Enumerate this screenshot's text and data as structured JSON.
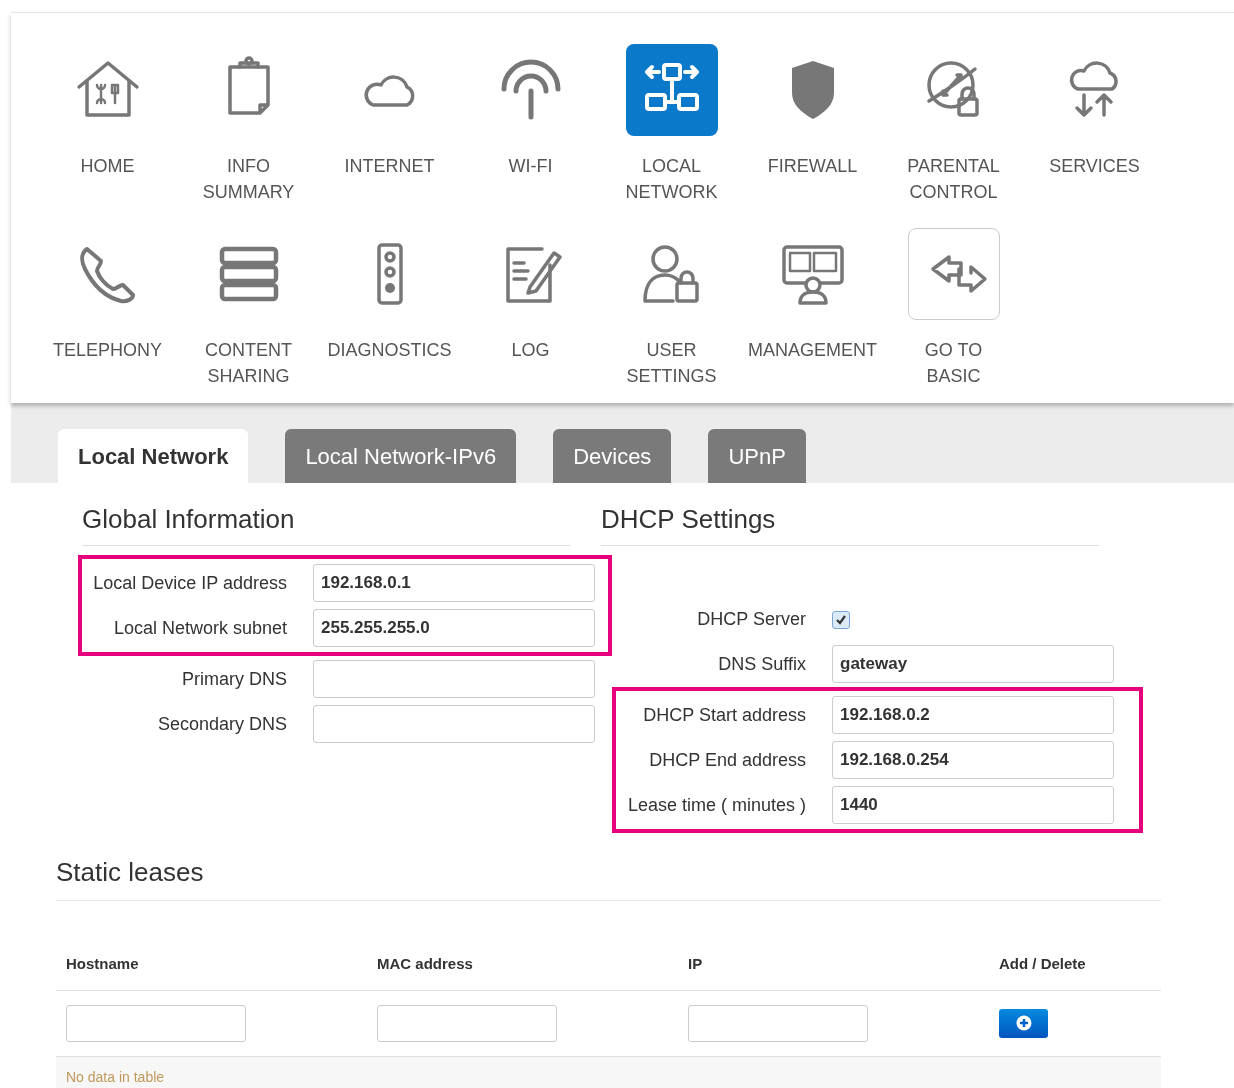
{
  "nav_menu": [
    {
      "label": "HOME",
      "kind": "page",
      "selected": false
    },
    {
      "label": "INFO SUMMARY",
      "kind": "page",
      "selected": false
    },
    {
      "label": "INTERNET",
      "kind": "page",
      "selected": false
    },
    {
      "label": "WI-FI",
      "kind": "page",
      "selected": false
    },
    {
      "label": "LOCAL NETWORK",
      "kind": "page",
      "selected": true
    },
    {
      "label": "FIREWALL",
      "kind": "page",
      "selected": false
    },
    {
      "label": "PARENTAL CONTROL",
      "kind": "page",
      "selected": false
    },
    {
      "label": "SERVICES",
      "kind": "page",
      "selected": false
    },
    {
      "label": "TELEPHONY",
      "kind": "page",
      "selected": false
    },
    {
      "label": "CONTENT SHARING",
      "kind": "page",
      "selected": false
    },
    {
      "label": "DIAGNOSTICS",
      "kind": "page",
      "selected": false
    },
    {
      "label": "LOG",
      "kind": "page",
      "selected": false
    },
    {
      "label": "USER SETTINGS",
      "kind": "page",
      "selected": false
    },
    {
      "label": "MANAGEMENT",
      "kind": "page",
      "selected": false
    },
    {
      "label": "GO TO BASIC",
      "kind": "switch",
      "selected": false
    }
  ],
  "tabs": [
    {
      "label": "Local Network",
      "selected": true
    },
    {
      "label": "Local Network-IPv6",
      "selected": false
    },
    {
      "label": "Devices",
      "selected": false
    },
    {
      "label": "UPnP",
      "selected": false
    }
  ],
  "global_information": {
    "title": "Global Information",
    "groups": [
      {
        "highlighted": true,
        "fields": [
          {
            "label": "Local Device IP address",
            "kind": "text",
            "value": "192.168.0.1"
          },
          {
            "label": "Local Network subnet",
            "kind": "text",
            "value": "255.255.255.0"
          }
        ]
      },
      {
        "highlighted": false,
        "fields": [
          {
            "label": "Primary DNS",
            "kind": "text"
          },
          {
            "label": "Secondary DNS",
            "kind": "text"
          }
        ]
      }
    ]
  },
  "dhcp_settings": {
    "title": "DHCP Settings",
    "groups": [
      {
        "highlighted": false,
        "fields": [
          {
            "label": "DHCP Server",
            "kind": "checkbox",
            "checked": true
          },
          {
            "label": "DNS Suffix",
            "kind": "text",
            "value": "gateway"
          }
        ]
      },
      {
        "highlighted": true,
        "fields": [
          {
            "label": "DHCP Start address",
            "kind": "text",
            "value": "192.168.0.2"
          },
          {
            "label": "DHCP End address",
            "kind": "text",
            "value": "192.168.0.254"
          },
          {
            "label": "Lease time ( minutes )",
            "kind": "text",
            "value": "1440"
          }
        ]
      }
    ]
  },
  "static_leases": {
    "title": "Static leases",
    "columns": [
      "Hostname",
      "MAC address",
      "IP",
      "Add / Delete"
    ],
    "empty_message": "No data in table"
  }
}
